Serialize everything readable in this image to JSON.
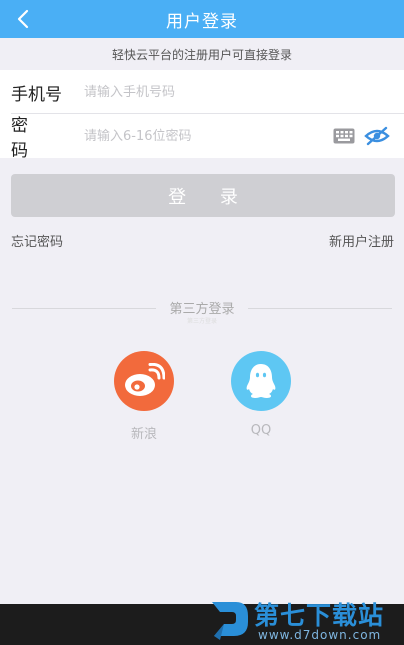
{
  "header": {
    "title": "用户登录",
    "back_icon": "chevron-left-icon"
  },
  "notice": "轻快云平台的注册用户可直接登录",
  "form": {
    "phone_label": "手机号",
    "phone_placeholder": "请输入手机号码",
    "password_label": "密 码",
    "password_placeholder": "请输入6-16位密码"
  },
  "login_button": "登 录",
  "links": {
    "forgot": "忘记密码",
    "register": "新用户注册"
  },
  "third_party": {
    "title": "第三方登录",
    "subtitle": "第三方登录",
    "options": [
      {
        "label": "新浪",
        "icon": "weibo-icon"
      },
      {
        "label": "QQ",
        "icon": "qq-icon"
      }
    ]
  },
  "watermark": {
    "name": "第七下载站",
    "url": "www.d7down.com"
  },
  "colors": {
    "header": "#4aaff5",
    "background": "#f0eff5",
    "login_button": "#cfcfd3",
    "weibo": "#f26a3c",
    "qq": "#5ec7f3"
  }
}
